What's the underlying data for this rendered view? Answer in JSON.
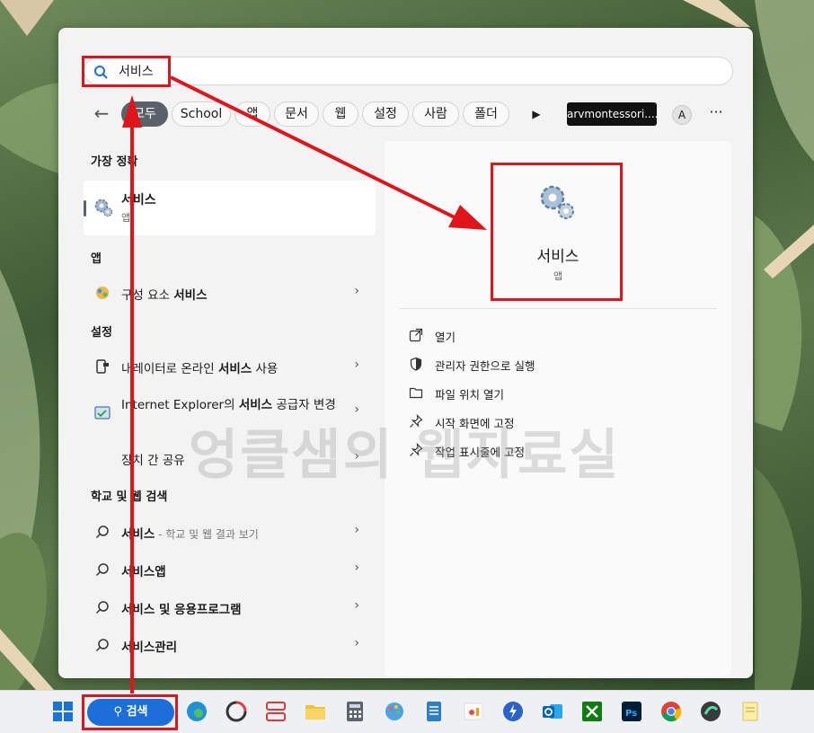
{
  "search": {
    "query": "서비스"
  },
  "filters": {
    "back_label": "←",
    "chips": [
      "모두",
      "School",
      "앱",
      "문서",
      "웹",
      "설정",
      "사람",
      "폴더"
    ],
    "account": "arvmontessori....",
    "avatar_letter": "A",
    "more_label": "···"
  },
  "sections": {
    "best_match": "가장 정확",
    "apps": "앱",
    "settings": "설정",
    "web": "학교 및 웹 검색"
  },
  "best_match": {
    "name": "서비스",
    "type": "앱"
  },
  "apps": [
    {
      "pre": "구성 요소 ",
      "bold": "서비스",
      "post": ""
    }
  ],
  "settings": [
    {
      "pre": "내레이터로 온라인 ",
      "bold": "서비스",
      "post": " 사용"
    },
    {
      "pre": "Internet Explorer의 ",
      "bold": "서비스",
      "post": " 공급자 변경"
    },
    {
      "pre": "장치 간 공유",
      "bold": "",
      "post": ""
    }
  ],
  "web_results": [
    {
      "bold": "서비스",
      "muted": " - 학교 및 웹 결과 보기",
      "post": ""
    },
    {
      "bold": "서비스앱",
      "muted": "",
      "post": ""
    },
    {
      "bold": "서비스 및 응용프로그램",
      "muted": "",
      "post": ""
    },
    {
      "bold": "서비스관리",
      "muted": "",
      "post": ""
    }
  ],
  "detail": {
    "name": "서비스",
    "type": "앱",
    "actions": [
      "열기",
      "관리자 권한으로 실행",
      "파일 위치 열기",
      "시작 화면에 고정",
      "작업 표시줄에 고정"
    ]
  },
  "watermark": "엉클샘의 웹자료실",
  "taskbar": {
    "search_label": "검색"
  },
  "colors": {
    "accent": "#1c6fd8",
    "annotation": "#e0141b",
    "chip_active": "#5a6169"
  }
}
